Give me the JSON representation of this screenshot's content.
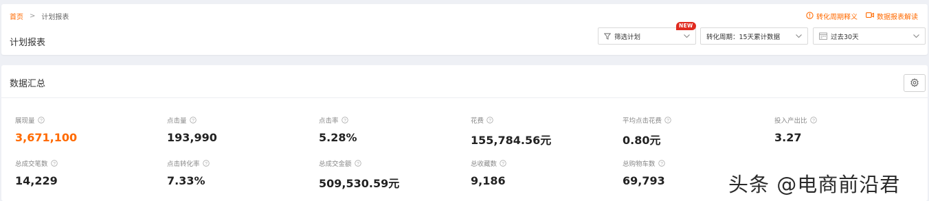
{
  "breadcrumb": {
    "home": "首页",
    "current": "计划报表"
  },
  "header": {
    "title": "计划报表",
    "links": [
      {
        "label": "转化周期释义",
        "icon": "info-circle-icon"
      },
      {
        "label": "数据报表解读",
        "icon": "video-icon"
      }
    ]
  },
  "filters": {
    "plan_filter": {
      "label": "筛选计划",
      "badge": "NEW",
      "icon": "funnel-icon"
    },
    "cycle": {
      "label": "转化周期：15天累计数据"
    },
    "date_range": {
      "label": "过去30天",
      "icon": "calendar-icon"
    }
  },
  "summary": {
    "title": "数据汇总",
    "metrics_row1": [
      {
        "label": "展现量",
        "value": "3,671,100"
      },
      {
        "label": "点击量",
        "value": "193,990"
      },
      {
        "label": "点击率",
        "value": "5.28%"
      },
      {
        "label": "花费",
        "value": "155,784.56元"
      },
      {
        "label": "平均点击花费",
        "value": "0.80元"
      },
      {
        "label": "投入产出比",
        "value": "3.27"
      }
    ],
    "metrics_row2": [
      {
        "label": "总成交笔数",
        "value": "14,229"
      },
      {
        "label": "点击转化率",
        "value": "7.33%"
      },
      {
        "label": "总成交金额",
        "value": "509,530.59元"
      },
      {
        "label": "总收藏数",
        "value": "9,186"
      },
      {
        "label": "总购物车数",
        "value": "69,793"
      }
    ]
  },
  "watermark": "头条 @电商前沿君",
  "colors": {
    "accent": "#ff6a00",
    "badge": "#e02a1f"
  }
}
